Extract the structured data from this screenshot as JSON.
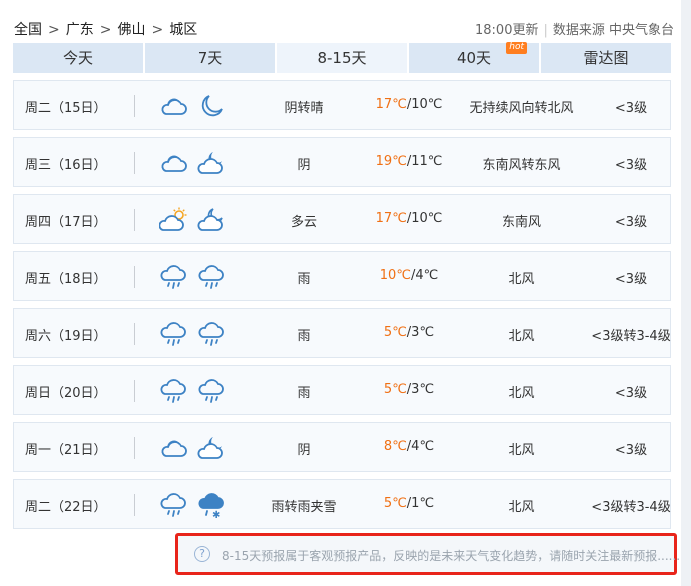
{
  "breadcrumb": {
    "items": [
      "全国",
      "广东",
      "佛山",
      "城区"
    ],
    "sep": ">"
  },
  "update": {
    "time": "18:00更新",
    "source": "数据来源 中央气象台"
  },
  "tabs": [
    {
      "label": "今天"
    },
    {
      "label": "7天"
    },
    {
      "label": "8-15天"
    },
    {
      "label": "40天",
      "badge": "hot"
    },
    {
      "label": "雷达图"
    }
  ],
  "days": [
    {
      "day": "周二（15日）",
      "icons": [
        "cloud-icon",
        "moon-icon"
      ],
      "desc": "阴转晴",
      "hi": "17℃",
      "lo": "/10℃",
      "wind": "无持续风向转北风",
      "level": "<3级"
    },
    {
      "day": "周三（16日）",
      "icons": [
        "cloud-icon",
        "cloud-moon-icon"
      ],
      "desc": "阴",
      "hi": "19℃",
      "lo": "/11℃",
      "wind": "东南风转东风",
      "level": "<3级"
    },
    {
      "day": "周四（17日）",
      "icons": [
        "cloud-sun-icon",
        "cloud-moon-icon"
      ],
      "desc": "多云",
      "hi": "17℃",
      "lo": "/10℃",
      "wind": "东南风",
      "level": "<3级"
    },
    {
      "day": "周五（18日）",
      "icons": [
        "rain-icon",
        "rain-icon"
      ],
      "desc": "雨",
      "hi": "10℃",
      "lo": "/4℃",
      "wind": "北风",
      "level": "<3级"
    },
    {
      "day": "周六（19日）",
      "icons": [
        "rain-icon",
        "rain-icon"
      ],
      "desc": "雨",
      "hi": "5℃",
      "lo": "/3℃",
      "wind": "北风",
      "level": "<3级转3-4级"
    },
    {
      "day": "周日（20日）",
      "icons": [
        "rain-icon",
        "rain-icon"
      ],
      "desc": "雨",
      "hi": "5℃",
      "lo": "/3℃",
      "wind": "北风",
      "level": "<3级"
    },
    {
      "day": "周一（21日）",
      "icons": [
        "cloud-icon",
        "cloud-moon-icon"
      ],
      "desc": "阴",
      "hi": "8℃",
      "lo": "/4℃",
      "wind": "北风",
      "level": "<3级"
    },
    {
      "day": "周二（22日）",
      "icons": [
        "rain-icon",
        "sleet-icon"
      ],
      "desc": "雨转雨夹雪",
      "hi": "5℃",
      "lo": "/1℃",
      "wind": "北风",
      "level": "<3级转3-4级"
    }
  ],
  "notice": {
    "icon_text": "?",
    "text": "8-15天预报属于客观预报产品，反映的是未来天气变化趋势，请随时关注最新预报......"
  },
  "colors": {
    "accent": "#3a7bc8",
    "hi_temp": "#f07014",
    "tab_bg": "#dbe7f4",
    "highlight_border": "#e8241a"
  }
}
